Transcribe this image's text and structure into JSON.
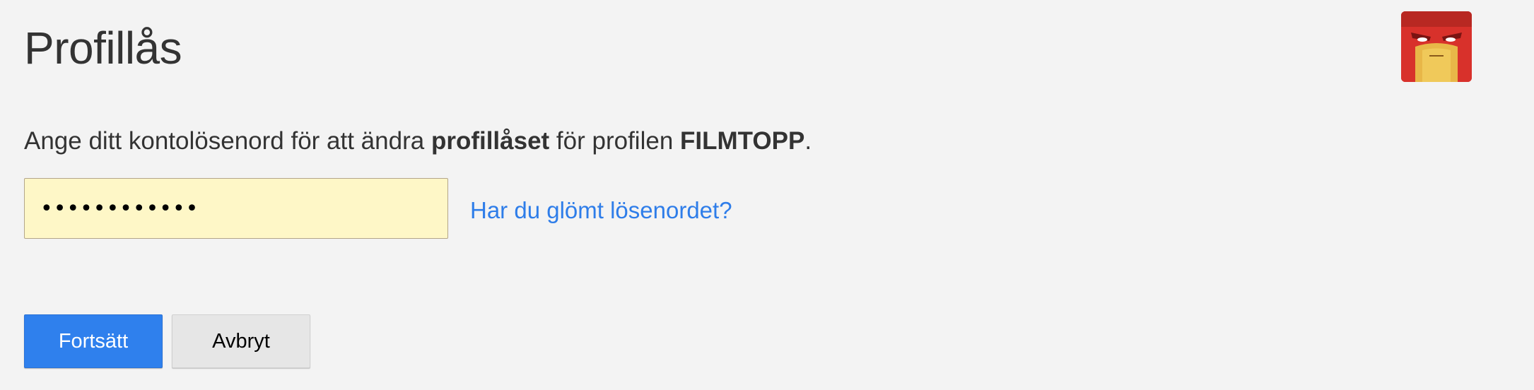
{
  "page": {
    "title": "Profillås"
  },
  "avatar": {
    "icon": "angry-red-face-avatar"
  },
  "instruction": {
    "prefix": "Ange ditt kontolösenord för att ändra ",
    "bold_1": "profillåset",
    "middle": " för profilen ",
    "bold_2": "FILMTOPP",
    "suffix": "."
  },
  "password": {
    "value": "••••••••••••"
  },
  "forgot_link": {
    "label": "Har du glömt lösenordet?"
  },
  "buttons": {
    "continue_label": "Fortsätt",
    "cancel_label": "Avbryt"
  },
  "colors": {
    "background": "#f3f3f3",
    "primary_button": "#2f80ed",
    "link": "#2e7de9",
    "input_autofill": "#fef7c7"
  }
}
